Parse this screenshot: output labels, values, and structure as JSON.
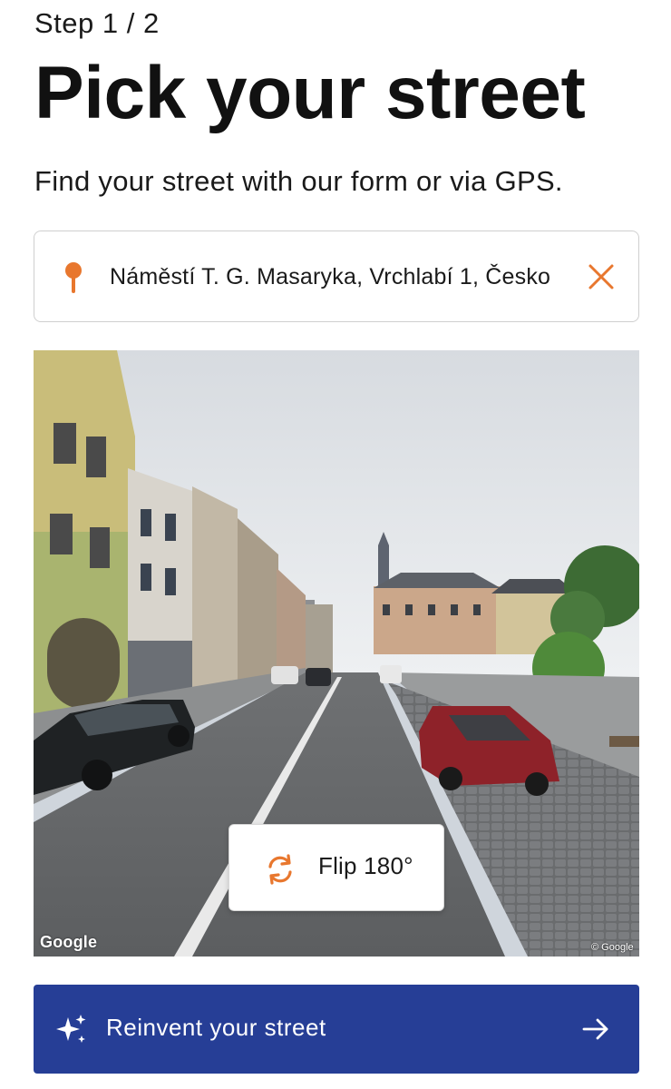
{
  "header": {
    "step": "Step 1 / 2",
    "title": "Pick your street",
    "subtitle": "Find your street with our form or via GPS."
  },
  "search": {
    "value": "Náměstí T. G. Masaryka, Vrchlabí 1, Česko",
    "pin_icon": "map-pin-icon",
    "clear_icon": "close-icon"
  },
  "street_view": {
    "flip_label": "Flip 180°",
    "flip_icon": "rotate-arrows-icon",
    "provider_logo": "Google",
    "copyright": "© Google"
  },
  "cta": {
    "label": "Reinvent your street",
    "sparkle_icon": "sparkle-icon",
    "arrow_icon": "arrow-right-icon"
  },
  "colors": {
    "accent_orange": "#e8772e",
    "primary_blue": "#263e96",
    "text": "#141414",
    "border": "#cfcfcf"
  }
}
